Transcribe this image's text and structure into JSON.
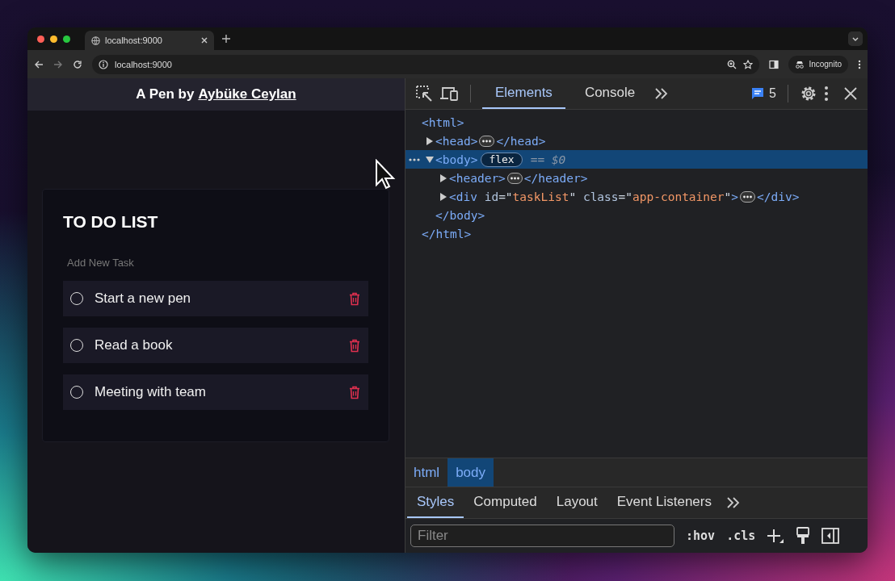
{
  "browser": {
    "tab_title": "localhost:9000",
    "url": "localhost:9000",
    "profile": "Incognito"
  },
  "page": {
    "header_prefix": "A Pen by",
    "author_link": "Aybüke Ceylan",
    "title": "TO DO LIST",
    "new_task": {
      "placeholder": "Add New Task"
    },
    "tasks": [
      {
        "text": "Start a new pen",
        "done": false
      },
      {
        "text": "Read a book",
        "done": false
      },
      {
        "text": "Meeting with team",
        "done": false
      }
    ]
  },
  "devtools": {
    "tabs": [
      {
        "label": "Elements",
        "selected": true
      },
      {
        "label": "Console",
        "selected": false
      }
    ],
    "issues_count": "5",
    "tree": [
      {
        "tokens": [
          {
            "kind": "tag",
            "text": "<html>"
          }
        ],
        "selected": false,
        "closing": [
          {
            "kind": "tag",
            "text": "</html>"
          }
        ],
        "children": [
          {
            "tokens": [
              {
                "kind": "tag",
                "text": "<head>"
              }
            ],
            "expanded": false,
            "selected": false,
            "end_tokens": [
              {
                "kind": "tag",
                "text": "</head>"
              }
            ]
          },
          {
            "tokens": [
              {
                "kind": "tag",
                "text": "<body>"
              }
            ],
            "expanded": true,
            "selected": true,
            "badge": "flex",
            "note": "== $0",
            "closing": [
              {
                "kind": "tag",
                "text": "</body>"
              }
            ],
            "children": [
              {
                "tokens": [
                  {
                    "kind": "tag",
                    "text": "<header>"
                  }
                ],
                "expanded": false,
                "selected": false,
                "end_tokens": [
                  {
                    "kind": "tag",
                    "text": "</header>"
                  }
                ]
              },
              {
                "tokens": [
                  {
                    "kind": "tag",
                    "text": "<div"
                  },
                  {
                    "kind": "attr",
                    "text": " id"
                  },
                  {
                    "kind": "punct",
                    "text": "=\""
                  },
                  {
                    "kind": "value",
                    "text": "taskList"
                  },
                  {
                    "kind": "punct",
                    "text": "\""
                  },
                  {
                    "kind": "attr",
                    "text": " class"
                  },
                  {
                    "kind": "punct",
                    "text": "=\""
                  },
                  {
                    "kind": "value",
                    "text": "app-container"
                  },
                  {
                    "kind": "punct",
                    "text": "\""
                  },
                  {
                    "kind": "tag",
                    "text": ">"
                  }
                ],
                "expanded": false,
                "selected": false,
                "end_tokens": [
                  {
                    "kind": "tag",
                    "text": "</div>"
                  }
                ]
              }
            ]
          }
        ]
      }
    ],
    "breadcrumbs": [
      {
        "label": "html",
        "selected": false
      },
      {
        "label": "body",
        "selected": true
      }
    ],
    "style_tabs": [
      {
        "label": "Styles",
        "selected": true
      },
      {
        "label": "Computed",
        "selected": false
      },
      {
        "label": "Layout",
        "selected": false
      },
      {
        "label": "Event Listeners",
        "selected": false
      }
    ],
    "filter": {
      "placeholder": "Filter"
    },
    "hov": ":hov",
    "cls": ".cls"
  }
}
